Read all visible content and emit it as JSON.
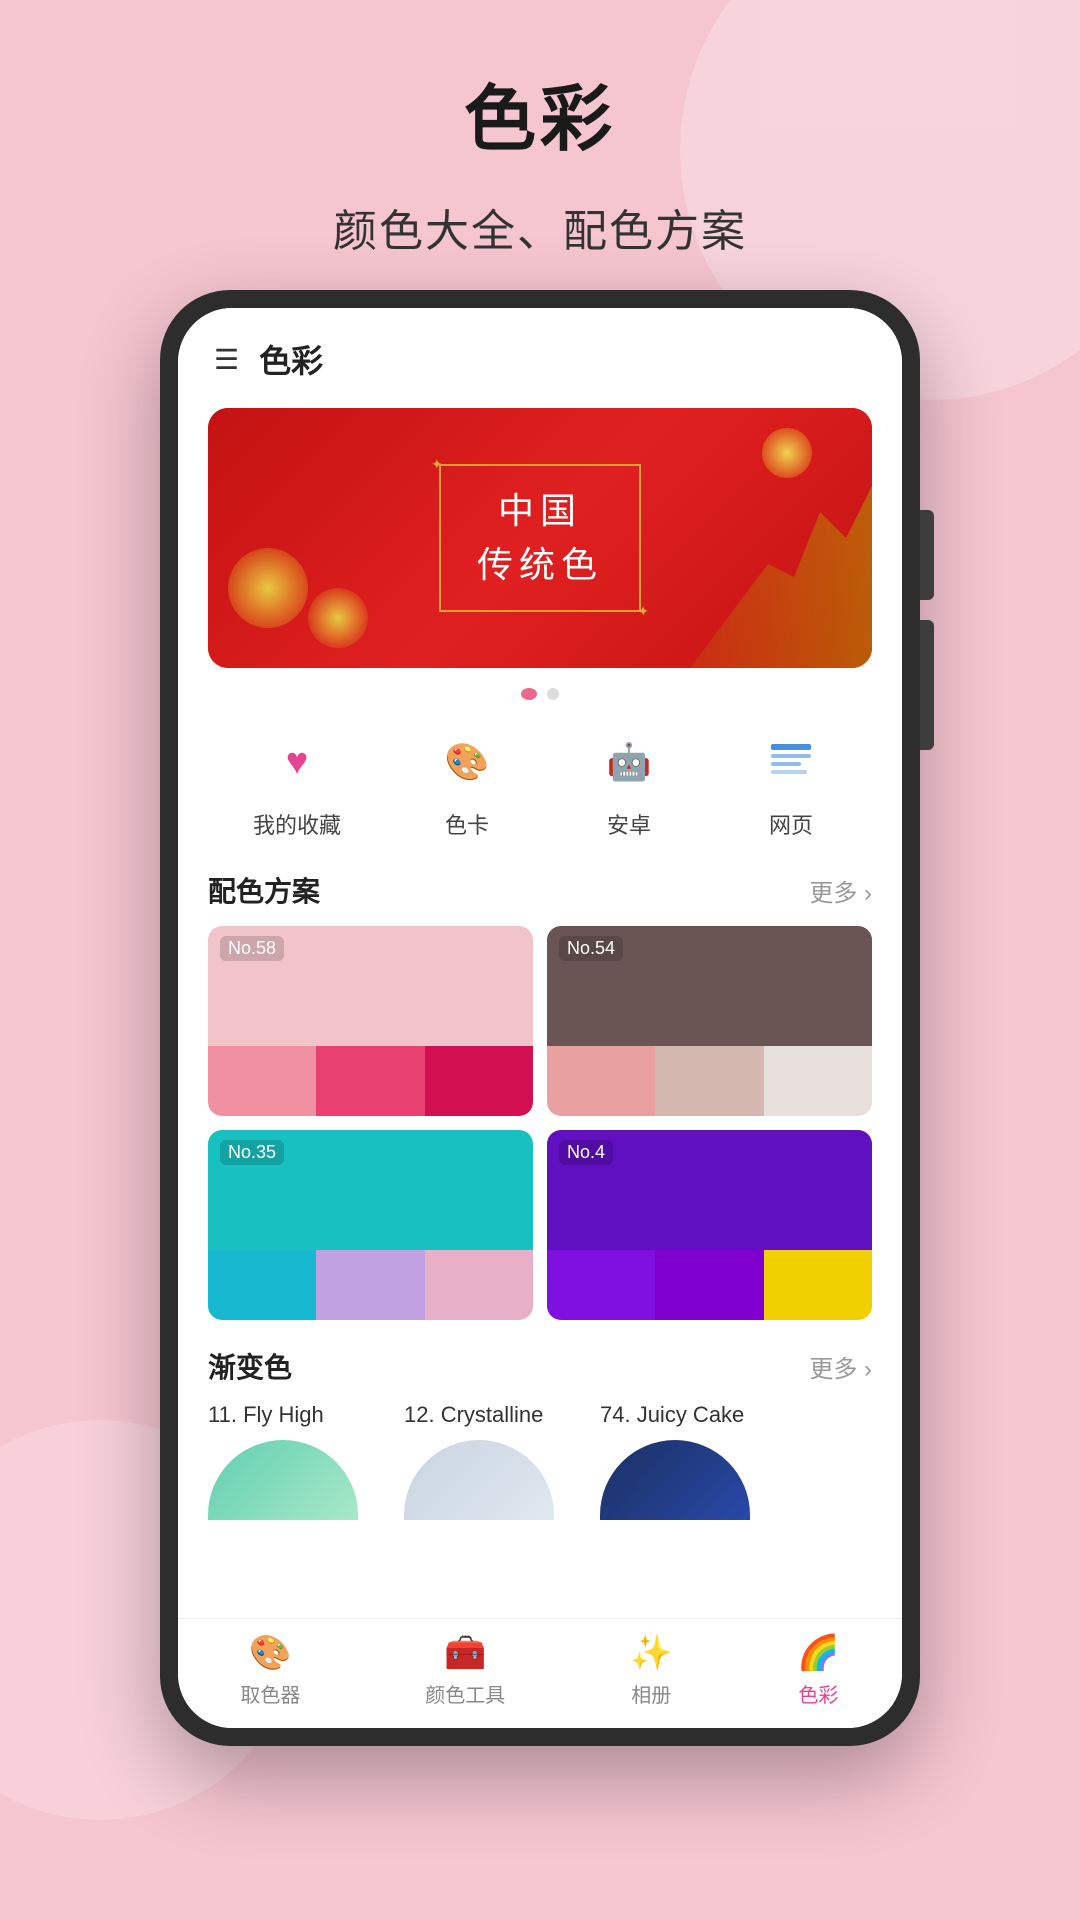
{
  "page": {
    "title": "色彩",
    "subtitle": "颜色大全、配色方案"
  },
  "app": {
    "title": "色彩",
    "hamburger_label": "☰"
  },
  "banner": {
    "title_line1": "中国",
    "title_line2": "传统色",
    "dot_count": 2,
    "active_dot": 0
  },
  "categories": [
    {
      "id": "favorites",
      "icon": "♥",
      "label": "我的收藏",
      "icon_type": "heart"
    },
    {
      "id": "color-card",
      "icon": "🎨",
      "label": "色卡",
      "icon_type": "palette"
    },
    {
      "id": "android",
      "icon": "🤖",
      "label": "安卓",
      "icon_type": "android"
    },
    {
      "id": "web",
      "icon": "🌐",
      "label": "网页",
      "icon_type": "web"
    }
  ],
  "palette_section": {
    "title": "配色方案",
    "more_label": "更多 ›"
  },
  "palettes": [
    {
      "no": "No.58",
      "top_color": "#f0c4c8",
      "swatches": [
        "#f090a0",
        "#e84070",
        "#d01050"
      ]
    },
    {
      "no": "No.54",
      "top_color": "#6a5555",
      "swatches": [
        "#e8a0a0",
        "#d4b8b0",
        "#e8e0dc"
      ]
    },
    {
      "no": "No.35",
      "top_color": "#18c0c0",
      "swatches": [
        "#18b8d0",
        "#c0a0e0",
        "#e8b0c8"
      ]
    },
    {
      "no": "No.4",
      "top_color": "#6010c0",
      "swatches": [
        "#8010e0",
        "#8000d0",
        "#f0d000"
      ]
    }
  ],
  "gradient_section": {
    "title": "渐变色",
    "more_label": "更多 ›"
  },
  "gradients": [
    {
      "id": 11,
      "title": "11. Fly High",
      "color_start": "#60d0b0",
      "color_end": "#a0e8c8"
    },
    {
      "id": 12,
      "title": "12. Crystalline",
      "color_start": "#d0d8e0",
      "color_end": "#b8c8d8"
    },
    {
      "id": 74,
      "title": "74. Juicy Cake",
      "color_start": "#1a3060",
      "color_end": "#2040a0"
    }
  ],
  "bottom_nav": [
    {
      "id": "color-picker",
      "icon": "🎨",
      "label": "取色器",
      "active": false
    },
    {
      "id": "color-tools",
      "icon": "🧰",
      "label": "颜色工具",
      "active": false
    },
    {
      "id": "album",
      "icon": "✨",
      "label": "相册",
      "active": false
    },
    {
      "id": "color",
      "icon": "🌈",
      "label": "色彩",
      "active": true
    }
  ]
}
